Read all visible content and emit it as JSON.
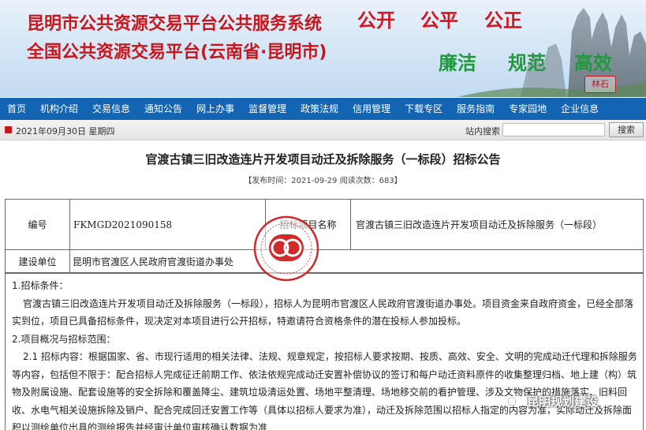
{
  "banner": {
    "title_line1": "昆明市公共资源交易平台公共服务系统",
    "title_line2": "全国公共资源交易平台(云南省·昆明市)",
    "slogans": [
      "公开",
      "公平",
      "公正",
      "廉洁",
      "规范",
      "高效"
    ],
    "seal_text": "林石"
  },
  "nav": {
    "items": [
      "首页",
      "机构介绍",
      "交易信息",
      "通知公告",
      "网上办事",
      "监督管理",
      "政策法规",
      "信用管理",
      "下载专区",
      "服务指南",
      "专家园地",
      "企业信息"
    ]
  },
  "datebar": {
    "date": "2021年09月30日 星期四",
    "search_label": "站内搜索",
    "search_placeholder": "",
    "search_button": "搜索"
  },
  "article": {
    "title": "官渡古镇三旧改造连片开发项目动迁及拆除服务（一标段）招标公告",
    "meta": "【发布时间：2021-09-29 阅读次数：683】"
  },
  "info_table": {
    "code_label": "编号",
    "code_value": "FKMGD2021090158",
    "name_label": "招标项目名称",
    "name_value": "官渡古镇三旧改造连片开发项目动迁及拆除服务（一标段）",
    "unit_label": "建设单位",
    "unit_value": "昆明市官渡区人民政府官渡街道办事处"
  },
  "body": {
    "section1_heading": "1.招标条件：",
    "section1_text": "官渡古镇三旧改造连片开发项目动迁及拆除服务（一标段），招标人为昆明市官渡区人民政府官渡街道办事处。项目资金来自政府资金，已经全部落实到位，项目已具备招标条件，现决定对本项目进行公开招标，特邀请符合资格条件的潜在投标人参加投标。",
    "section2_heading": "2.项目概况与招标范围：",
    "section2_text": "2.1 招标内容：根据国家、省、市现行适用的相关法律、法规、规章规定，按招标人要求按期、按质、高效、安全、文明的完成动迁代理和拆除服务等内容，包括但不限于：配合招标人完成征迁前期工作、依法依规完成动迁安置补偿协议的签订和每户动迁资料原件的收集整理归档、地上建（构）筑物及附属设施、配套设施等的安全拆除和覆盖降尘、建筑垃圾清运处置、场地平整清理、场地移交前的看护管理、涉及文物保护的措施落实、旧料回收、水电气相关设施拆除及销户、配合完成回迁安置工作等（具体以招标人要求为准），动迁及拆除范围以招标人指定的内容为准，实际动迁及拆除面积以测绘单位出具的测绘报告并经审计单位审核确认数据为准"
  },
  "watermark": {
    "text": "昆明规划建设"
  },
  "colors": {
    "nav_bg": "#1464b4",
    "title_red": "#c8161d",
    "slogan_green": "#1f9a3b"
  }
}
